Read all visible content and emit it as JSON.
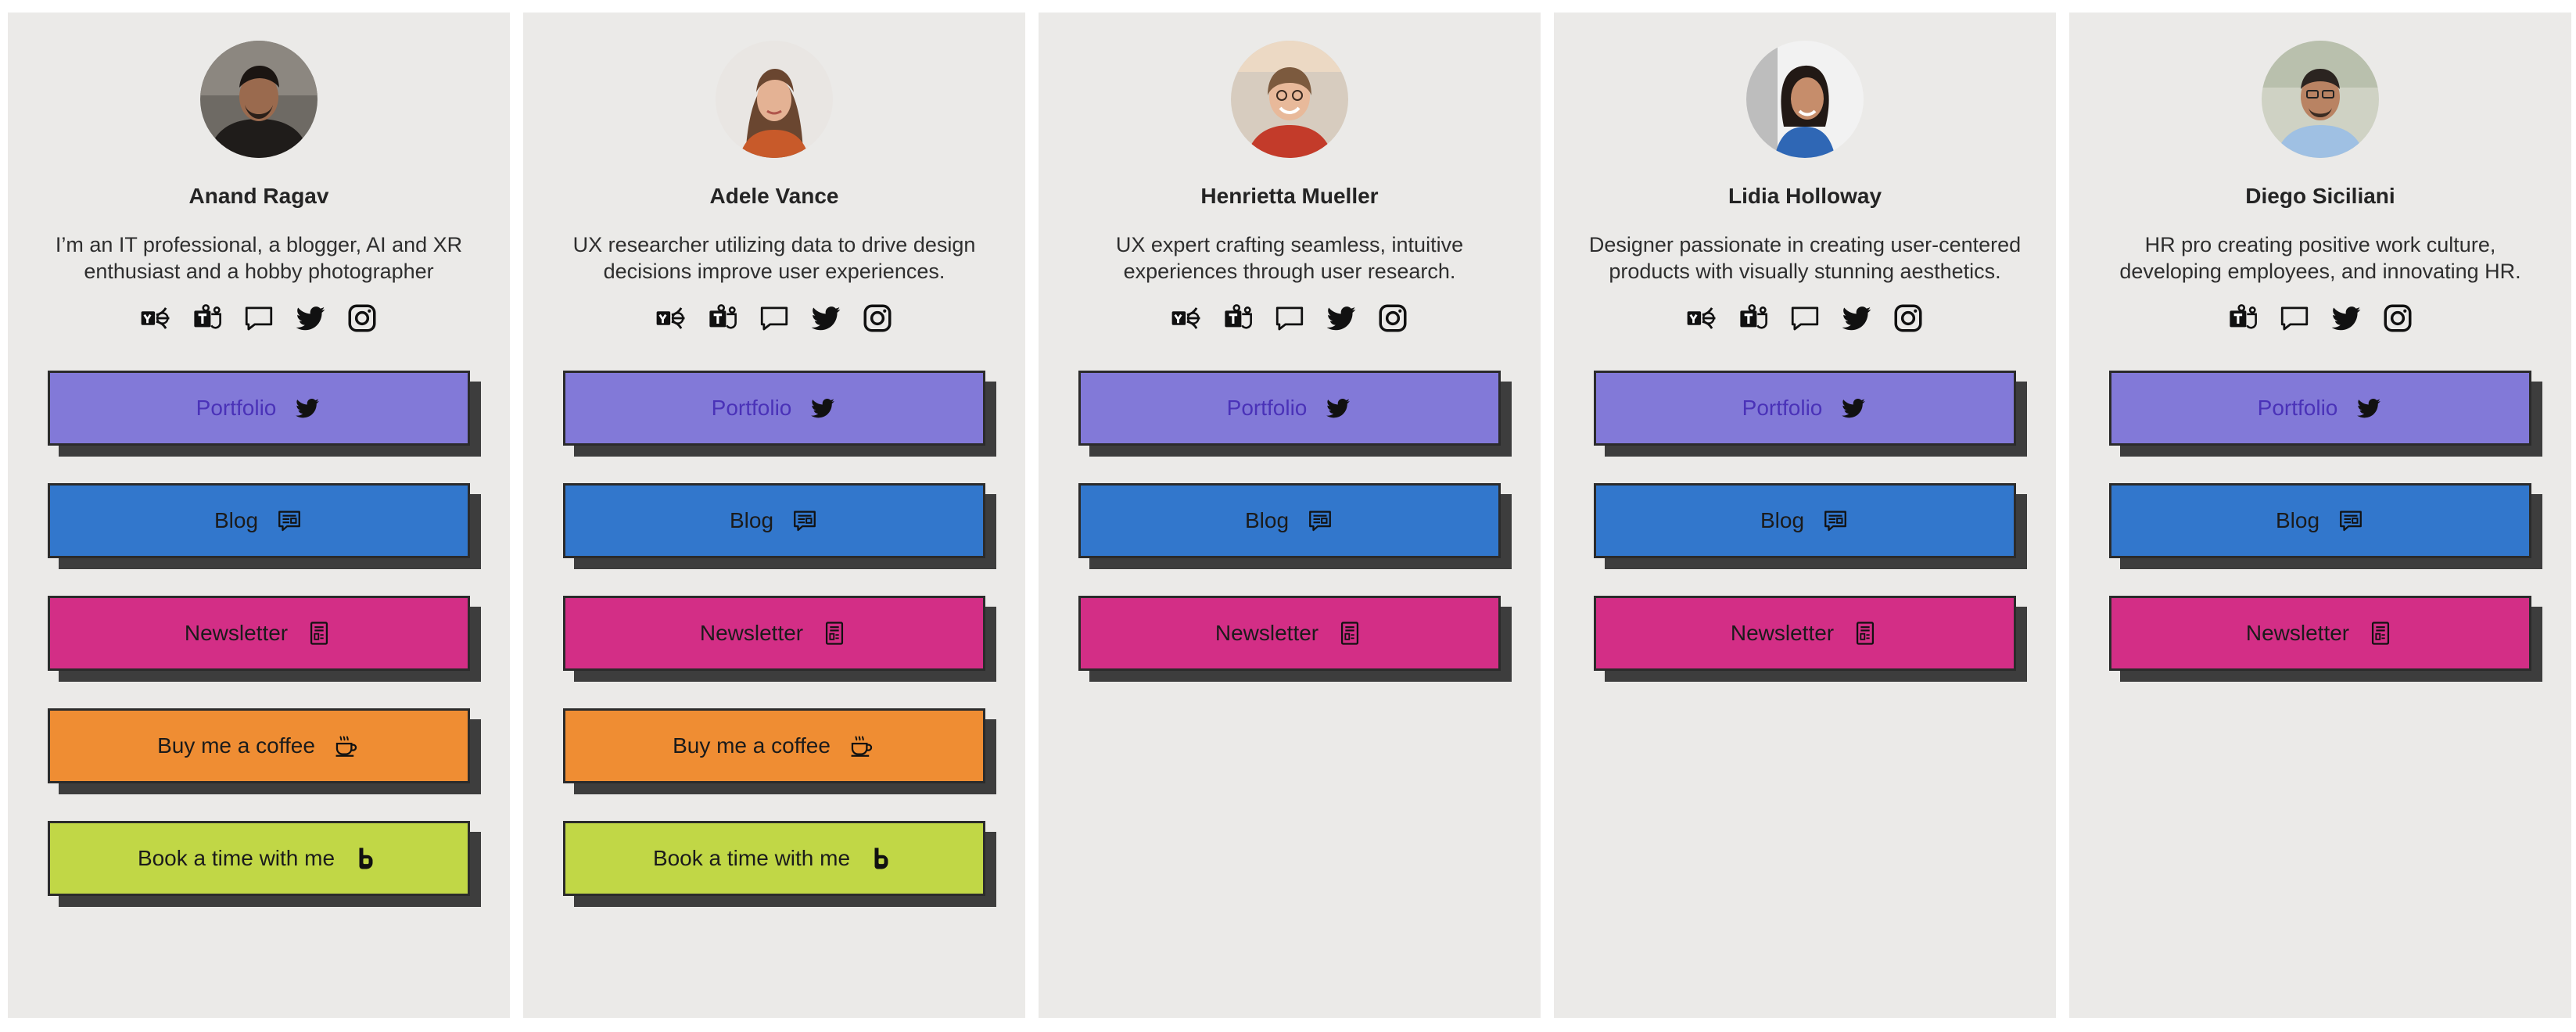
{
  "colors": {
    "card_bg": "#ebeae8",
    "portfolio": "#8279d8",
    "portfolio_text": "#4a32b8",
    "blog": "#3277cc",
    "newsletter": "#d32e86",
    "coffee": "#ef8d33",
    "booking": "#c1d746"
  },
  "cards": [
    {
      "name": "Anand Ragav",
      "bio": "I’m an IT professional, a blogger, AI and XR enthusiast and a hobby photographer",
      "socials": [
        "yammer-icon",
        "teams-icon",
        "chat-icon",
        "twitter-icon",
        "instagram-icon"
      ],
      "links": [
        {
          "label": "Portfolio",
          "icon": "twitter-icon",
          "kind": "portfolio"
        },
        {
          "label": "Blog",
          "icon": "blog-icon",
          "kind": "blog"
        },
        {
          "label": "Newsletter",
          "icon": "newsletter-icon",
          "kind": "newsletter"
        },
        {
          "label": "Buy me a coffee",
          "icon": "coffee-icon",
          "kind": "coffee"
        },
        {
          "label": "Book a time with me",
          "icon": "bookings-icon",
          "kind": "booking"
        }
      ]
    },
    {
      "name": "Adele Vance",
      "bio": "UX researcher utilizing data to drive design decisions improve user experiences.",
      "socials": [
        "yammer-icon",
        "teams-icon",
        "chat-icon",
        "twitter-icon",
        "instagram-icon"
      ],
      "links": [
        {
          "label": "Portfolio",
          "icon": "twitter-icon",
          "kind": "portfolio"
        },
        {
          "label": "Blog",
          "icon": "blog-icon",
          "kind": "blog"
        },
        {
          "label": "Newsletter",
          "icon": "newsletter-icon",
          "kind": "newsletter"
        },
        {
          "label": "Buy me a coffee",
          "icon": "coffee-icon",
          "kind": "coffee"
        },
        {
          "label": "Book a time with me",
          "icon": "bookings-icon",
          "kind": "booking"
        }
      ]
    },
    {
      "name": "Henrietta Mueller",
      "bio": "UX expert crafting seamless, intuitive experiences through user research.",
      "socials": [
        "yammer-icon",
        "teams-icon",
        "chat-icon",
        "twitter-icon",
        "instagram-icon"
      ],
      "links": [
        {
          "label": "Portfolio",
          "icon": "twitter-icon",
          "kind": "portfolio"
        },
        {
          "label": "Blog",
          "icon": "blog-icon",
          "kind": "blog"
        },
        {
          "label": "Newsletter",
          "icon": "newsletter-icon",
          "kind": "newsletter"
        }
      ]
    },
    {
      "name": "Lidia Holloway",
      "bio": "Designer passionate in creating user-centered products with visually stunning aesthetics.",
      "socials": [
        "yammer-icon",
        "teams-icon",
        "chat-icon",
        "twitter-icon",
        "instagram-icon"
      ],
      "links": [
        {
          "label": "Portfolio",
          "icon": "twitter-icon",
          "kind": "portfolio"
        },
        {
          "label": "Blog",
          "icon": "blog-icon",
          "kind": "blog"
        },
        {
          "label": "Newsletter",
          "icon": "newsletter-icon",
          "kind": "newsletter"
        }
      ]
    },
    {
      "name": "Diego Siciliani",
      "bio": "HR pro creating positive work culture, developing employees, and innovating HR.",
      "socials": [
        "teams-icon",
        "chat-icon",
        "twitter-icon",
        "instagram-icon"
      ],
      "links": [
        {
          "label": "Portfolio",
          "icon": "twitter-icon",
          "kind": "portfolio"
        },
        {
          "label": "Blog",
          "icon": "blog-icon",
          "kind": "blog"
        },
        {
          "label": "Newsletter",
          "icon": "newsletter-icon",
          "kind": "newsletter"
        }
      ]
    }
  ]
}
